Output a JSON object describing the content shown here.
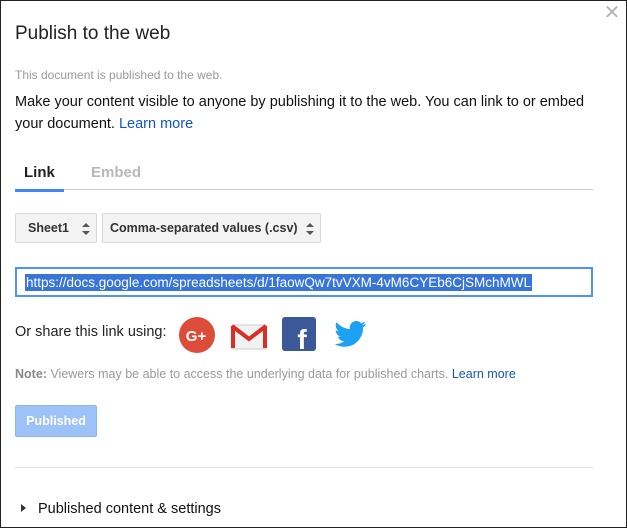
{
  "dialog": {
    "title": "Publish to the web",
    "close_icon": "close-icon",
    "status": "This document is published to the web.",
    "description": "Make your content visible to anyone by publishing it to the web. You can link to or embed your document.",
    "learn_more": "Learn more",
    "tabs": [
      {
        "label": "Link",
        "active": true
      },
      {
        "label": "Embed",
        "active": false
      }
    ],
    "sheet_select": {
      "value": "Sheet1"
    },
    "format_select": {
      "value": "Comma-separated values (.csv)"
    },
    "url": "https://docs.google.com/spreadsheets/d/1faowQw7tvVXM-4vM6CYEb6CjSMchMWL",
    "share_label": "Or share this link using:",
    "share_icons": [
      "google-plus-icon",
      "gmail-icon",
      "facebook-icon",
      "twitter-icon"
    ],
    "note_label": "Note:",
    "note_text": "Viewers may be able to access the underlying data for published charts.",
    "note_link": "Learn more",
    "published_button": "Published",
    "settings_label": "Published content & settings"
  },
  "colors": {
    "accent": "#4285f4",
    "link": "#1155cc",
    "button_disabled": "#9cc2f8",
    "google_plus": "#dd4b39",
    "gmail": "#d93025",
    "facebook": "#3b5998",
    "twitter": "#1da1f2"
  }
}
